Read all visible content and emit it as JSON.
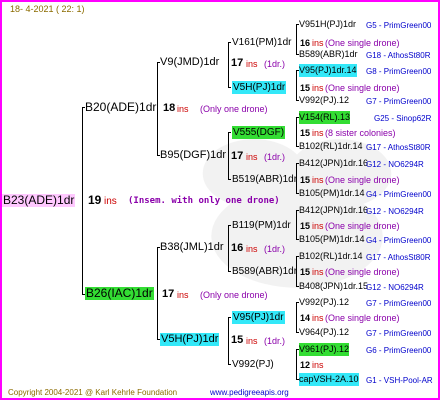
{
  "header": {
    "date": "18-  4-2021 ( 22:  1)"
  },
  "root": {
    "label": "B23(ADE)1dr",
    "num": "19",
    "ins": "ins",
    "note": "(Insem. with only one drone)"
  },
  "gen1": {
    "top": {
      "label": "B20(ADE)1dr",
      "num": "18",
      "ins": "ins",
      "note": "(Only one drone)"
    },
    "bottom": {
      "label": "B26(IAC)1dr",
      "num": "17",
      "ins": "ins",
      "note": "(Only one drone)"
    }
  },
  "gen2": [
    {
      "label": "V9(JMD)1dr",
      "num": "17",
      "ins": "ins",
      "note": "(1dr.)"
    },
    {
      "label": "B95(DGF)1dr",
      "num": "17",
      "ins": "ins",
      "note": "(1dr.)"
    },
    {
      "label": "B38(JML)1dr",
      "num": "16",
      "ins": "ins",
      "note": "(1dr.)"
    },
    {
      "label": "V5H(PJ)1dr",
      "num": "15",
      "ins": "ins",
      "note": "(1dr.)"
    }
  ],
  "gen3": [
    {
      "label": "V161(PM)1dr",
      "num": "16",
      "ins": "ins",
      "note": "(One single drone)"
    },
    {
      "label": "V5H(PJ)1dr",
      "num": "15",
      "ins": "ins",
      "note": "(One single drone)"
    },
    {
      "label": "V555(DGF)",
      "num": "15",
      "ins": "ins",
      "note": "(8 sister colonies)"
    },
    {
      "label": "B519(ABR)1dr",
      "num": "15",
      "ins": "ins",
      "note": "(One single drone)"
    },
    {
      "label": "B119(PM)1dr",
      "num": "15",
      "ins": "ins",
      "note": "(One single drone)"
    },
    {
      "label": "B589(ABR)1dr",
      "num": "15",
      "ins": "ins",
      "note": "(One single drone)"
    },
    {
      "label": "V95(PJ)1dr",
      "num": "14",
      "ins": "ins",
      "note": "(One single drone)"
    },
    {
      "label": "V992(PJ)",
      "num": "12",
      "ins": "ins",
      "note": ""
    }
  ],
  "gen4": [
    {
      "label": "V951H(PJ)1dr",
      "ref": "G5 - PrimGreen00"
    },
    {
      "label": "B589(ABR)1dr",
      "ref": "G18 - AthosSt80R"
    },
    {
      "label": "V95(PJ)1dr.14",
      "ref": "G8 - PrimGreen00"
    },
    {
      "label": "V992(PJ).12",
      "ref": "G7 - PrimGreen00"
    },
    {
      "label": "V154(RL).13",
      "ref": "G25 - Sinop62R"
    },
    {
      "label": "B102(RL)1dr.14",
      "ref": "G17 - AthosSt80R"
    },
    {
      "label": "B412(JPN)1dr.16",
      "ref": "G12 - NO6294R"
    },
    {
      "label": "B105(PM)1dr.14",
      "ref": "G4 - PrimGreen00"
    },
    {
      "label": "B412(JPN)1dr.16",
      "ref": "G12 - NO6294R"
    },
    {
      "label": "B105(PM)1dr.14",
      "ref": "G4 - PrimGreen00"
    },
    {
      "label": "B102(RL)1dr.14",
      "ref": "G17 - AthosSt80R"
    },
    {
      "label": "B408(JPN)1dr.15",
      "ref": "G12 - NO6294R"
    },
    {
      "label": "V992(PJ).12",
      "ref": "G7 - PrimGreen00"
    },
    {
      "label": "V964(PJ).12",
      "ref": "G7 - PrimGreen00"
    },
    {
      "label": "V961(PJ).12",
      "ref": "G6 - PrimGreen00"
    },
    {
      "label": "capVSH-2A.10",
      "ref": "G1 - VSH-Pool-AR"
    }
  ],
  "footer": {
    "copyright": "Copyright 2004-2021 @ Karl Kehrle Foundation",
    "site": "www.pedigreeapis.org"
  }
}
